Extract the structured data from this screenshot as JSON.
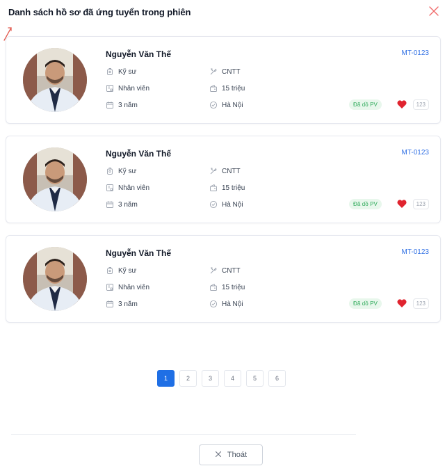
{
  "modal": {
    "title": "Danh sách hồ sơ đã ứng tuyển trong phiên"
  },
  "candidates": [
    {
      "name": "Nguyễn Văn Thế",
      "code": "MT-0123",
      "position": "Kỹ sư",
      "field": "CNTT",
      "level": "Nhân viên",
      "salary": "15 triệu",
      "experience": "3 năm",
      "location": "Hà Nội",
      "status": "Đã dồ PV",
      "likes": "123"
    },
    {
      "name": "Nguyễn Văn Thế",
      "code": "MT-0123",
      "position": "Kỹ sư",
      "field": "CNTT",
      "level": "Nhân viên",
      "salary": "15 triệu",
      "experience": "3 năm",
      "location": "Hà Nội",
      "status": "Đã dồ PV",
      "likes": "123"
    },
    {
      "name": "Nguyễn Văn Thế",
      "code": "MT-0123",
      "position": "Kỹ sư",
      "field": "CNTT",
      "level": "Nhân viên",
      "salary": "15 triệu",
      "experience": "3 năm",
      "location": "Hà Nội",
      "status": "Đã dồ PV",
      "likes": "123"
    }
  ],
  "pagination": {
    "pages": [
      "1",
      "2",
      "3",
      "4",
      "5",
      "6"
    ],
    "current": "1"
  },
  "footer": {
    "exit_label": "Thoát"
  },
  "colors": {
    "accent": "#1f6fe5",
    "code_link": "#2f6fe4",
    "status_bg": "#e8f7ec",
    "status_text": "#2eaa5a",
    "heart": "#e0242f",
    "close": "#f06b6b"
  },
  "icons": {
    "close": "close-icon",
    "position": "badge-icon",
    "field": "tools-icon",
    "level": "id-card-icon",
    "salary": "wallet-icon",
    "experience": "calendar-icon",
    "location": "check-circle-icon",
    "favorite": "heart-icon",
    "exit": "x-icon"
  }
}
